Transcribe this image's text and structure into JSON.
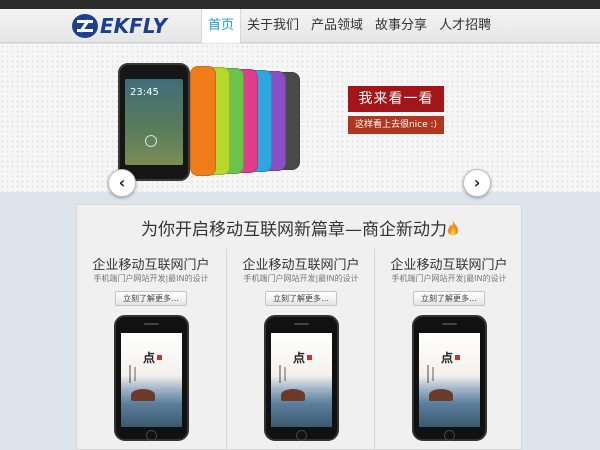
{
  "brand": {
    "logo_text": "EKFLY"
  },
  "nav": {
    "items": [
      {
        "label": "首页",
        "active": true
      },
      {
        "label": "关于我们",
        "active": false
      },
      {
        "label": "产品领域",
        "active": false
      },
      {
        "label": "故事分享",
        "active": false
      },
      {
        "label": "人才招聘",
        "active": false
      }
    ]
  },
  "banner": {
    "phone_time": "23:45",
    "cta_label": "我来看一看",
    "cta_sub": "这样看上去很nice :)",
    "phone_colors": [
      "#f07c1a",
      "#b7d82a",
      "#6cc24a",
      "#e03d8c",
      "#2ea7df",
      "#8a4fc2",
      "#4a4a4a"
    ],
    "prev_icon": "chevron-left-icon",
    "next_icon": "chevron-right-icon"
  },
  "section": {
    "title": "为你开启移动互联网新篇章—商企新动力",
    "columns": [
      {
        "title": "企业移动互联网门户",
        "subtitle": "手机端门户网站开发|最IN的设计",
        "button": "立刻了解更多…",
        "screen_char": "点"
      },
      {
        "title": "企业移动互联网门户",
        "subtitle": "手机端门户网站开发|最IN的设计",
        "button": "立刻了解更多…",
        "screen_char": "点"
      },
      {
        "title": "企业移动互联网门户",
        "subtitle": "手机端门户网站开发|最IN的设计",
        "button": "立刻了解更多…",
        "screen_char": "点"
      }
    ]
  },
  "colors": {
    "accent": "#1e9ad6",
    "brand": "#1d3f8f",
    "cta": "#a21518"
  }
}
